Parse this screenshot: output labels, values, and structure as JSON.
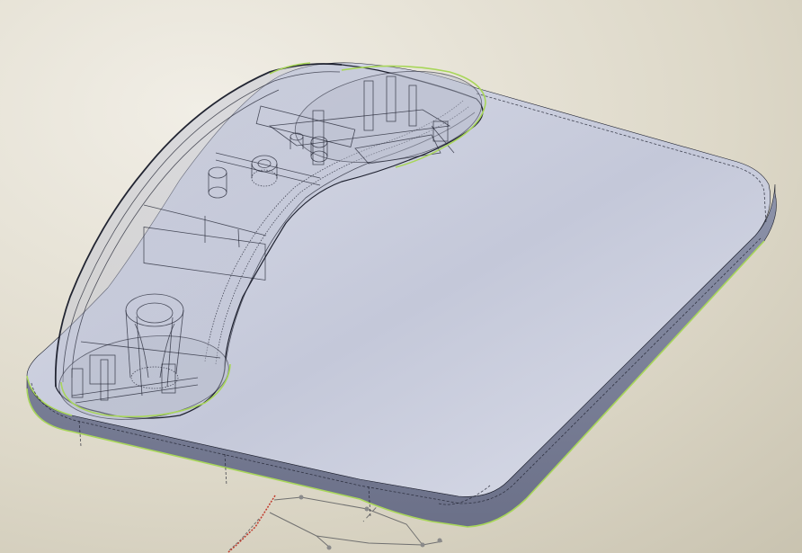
{
  "viewport": {
    "background_colors": [
      "#f1eee6",
      "#ddd8c8",
      "#c9c3b0"
    ],
    "model": {
      "body_fill": "#c4c8d9",
      "body_highlight": "#d6d9e6",
      "side_fill": "#8d93aa",
      "side_dark": "#6b7088",
      "edge_highlight": "#a8d65a",
      "transparent_fill": "#b8bccd",
      "wire_color": "#1f2230"
    },
    "sketch": {
      "line_color": "#707070",
      "accent_color": "#c0392b",
      "point_color": "#8a8a8a"
    }
  }
}
